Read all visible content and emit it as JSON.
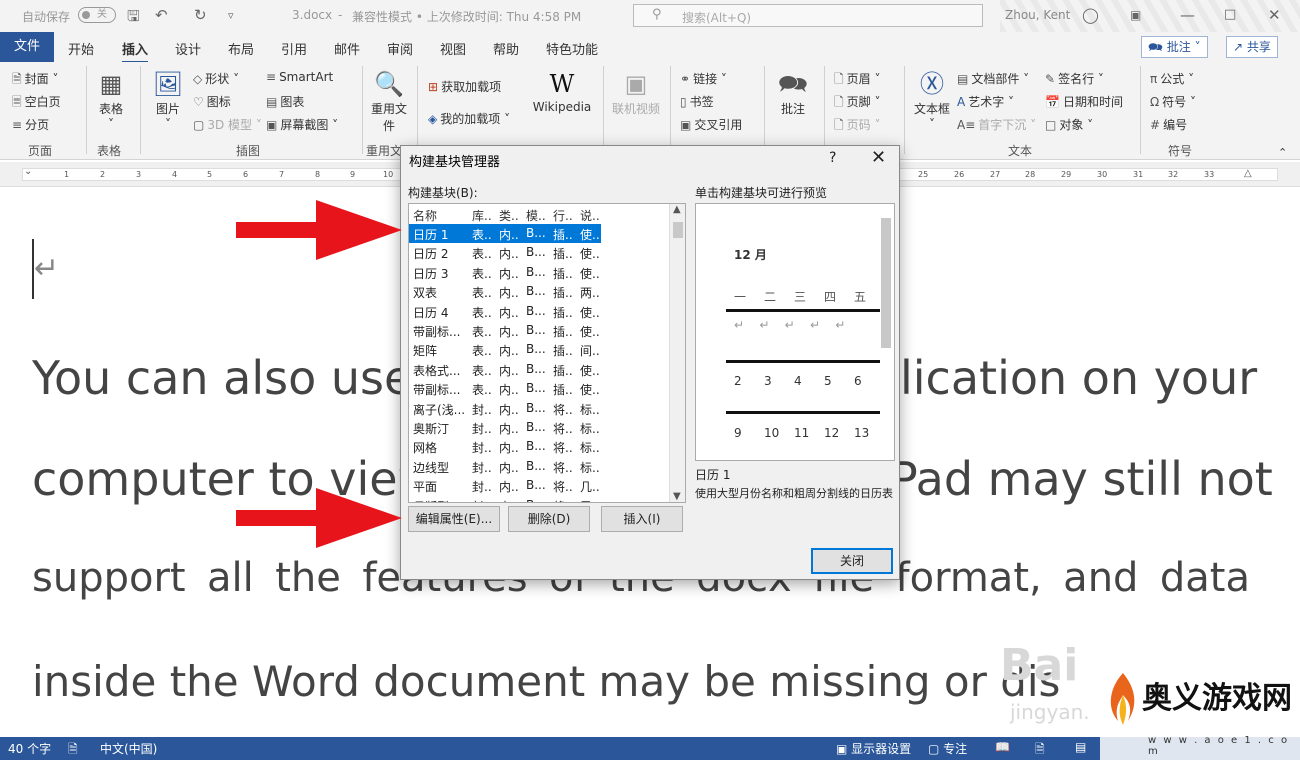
{
  "titlebar": {
    "autosave_label": "自动保存",
    "autosave_state": "关",
    "doc_name": "3.docx",
    "separator": "-",
    "mode": "兼容性模式 • 上次修改时间: Thu 4:58 PM",
    "search_placeholder": "搜索(Alt+Q)",
    "user": "Zhou, Kent"
  },
  "tabs": {
    "file": "文件",
    "items": [
      "开始",
      "插入",
      "设计",
      "布局",
      "引用",
      "邮件",
      "审阅",
      "视图",
      "帮助",
      "特色功能"
    ],
    "active": "插入",
    "comments_button": "批注",
    "share_button": "共享"
  },
  "ribbon": {
    "pages": {
      "cover": "封面",
      "blank": "空白页",
      "break": "分页",
      "group": "页面"
    },
    "tables": {
      "table": "表格",
      "group": "表格"
    },
    "illustrations": {
      "pictures": "图片",
      "shapes": "形状",
      "icons": "图标",
      "models3d": "3D 模型",
      "smartart": "SmartArt",
      "chart": "图表",
      "screenshot": "屏幕截图",
      "group": "插图"
    },
    "reuse": {
      "reuse": "重用文件",
      "group": "重用文"
    },
    "addins": {
      "get": "获取加载项",
      "my": "我的加载项",
      "wikipedia": "Wikipedia"
    },
    "media": {
      "video": "联机视频"
    },
    "links": {
      "link": "链接",
      "bookmark": "书签",
      "crossref": "交叉引用"
    },
    "comments": {
      "comment": "批注"
    },
    "headerfooter": {
      "header": "页眉",
      "footer": "页脚",
      "pagenum": "页码"
    },
    "text": {
      "textbox": "文本框",
      "quickparts": "文档部件",
      "wordart": "艺术字",
      "dropcap": "首字下沉",
      "signature": "签名行",
      "datetime": "日期和时间",
      "object": "对象",
      "group": "文本"
    },
    "symbols": {
      "equation": "公式",
      "symbol": "符号",
      "number": "编号",
      "group": "符号"
    }
  },
  "ruler_ticks": [
    "1",
    "2",
    "3",
    "4",
    "5",
    "6",
    "7",
    "8",
    "9",
    "10",
    "25",
    "26",
    "27",
    "28",
    "29",
    "30",
    "31",
    "32",
    "33"
  ],
  "document": {
    "lines": [
      "You can also use",
      "lication on your",
      "computer to view",
      "Pad may still not",
      "support all the features of the docx file format, and data",
      "inside the Word document may be missing or dis"
    ]
  },
  "dialog": {
    "title": "构建基块管理器",
    "help": "?",
    "list_label": "构建基块(B):",
    "preview_label": "单击构建基块可进行预览",
    "columns": [
      "名称",
      "库..",
      "类..",
      "模..",
      "行..",
      "说.."
    ],
    "rows": [
      [
        "日历 1",
        "表..",
        "内..",
        "B...",
        "插..",
        "使.."
      ],
      [
        "日历 2",
        "表..",
        "内..",
        "B...",
        "插..",
        "使.."
      ],
      [
        "日历 3",
        "表..",
        "内..",
        "B...",
        "插..",
        "使.."
      ],
      [
        "双表",
        "表..",
        "内..",
        "B...",
        "插..",
        "两.."
      ],
      [
        "日历 4",
        "表..",
        "内..",
        "B...",
        "插..",
        "使.."
      ],
      [
        "带副标...",
        "表..",
        "内..",
        "B...",
        "插..",
        "使.."
      ],
      [
        "矩阵",
        "表..",
        "内..",
        "B...",
        "插..",
        "间.."
      ],
      [
        "表格式...",
        "表..",
        "内..",
        "B...",
        "插..",
        "使.."
      ],
      [
        "带副标...",
        "表..",
        "内..",
        "B...",
        "插..",
        "使.."
      ],
      [
        "离子(浅...",
        "封..",
        "内..",
        "B...",
        "将..",
        "标.."
      ],
      [
        "奥斯汀",
        "封..",
        "内..",
        "B...",
        "将..",
        "标.."
      ],
      [
        "网格",
        "封..",
        "内..",
        "B...",
        "将..",
        "标.."
      ],
      [
        "边线型",
        "封..",
        "内..",
        "B...",
        "将..",
        "标.."
      ],
      [
        "平面",
        "封..",
        "内..",
        "B...",
        "将..",
        "几.."
      ],
      [
        "母版型",
        "封..",
        "内..",
        "B...",
        "将..",
        "导.."
      ]
    ],
    "preview": {
      "month": "12 月",
      "weekdays": [
        "一",
        "二",
        "三",
        "四",
        "五"
      ],
      "week2": [
        "2",
        "3",
        "4",
        "5",
        "6"
      ],
      "week3": [
        "9",
        "10",
        "11",
        "12",
        "13"
      ]
    },
    "selected_name": "日历 1",
    "selected_desc": "使用大型月份名称和粗周分割线的日历表",
    "buttons": {
      "edit": "编辑属性(E)...",
      "delete": "删除(D)",
      "insert": "插入(I)",
      "close": "关闭"
    }
  },
  "status": {
    "words": "40 个字",
    "language": "中文(中国)",
    "display": "显示器设置",
    "focus": "专注"
  },
  "watermark": {
    "logo_text": "奥义游戏网",
    "logo_url": "w w w . a o e 1 . c o m"
  },
  "colors": {
    "accent": "#2b579a",
    "selection": "#0078d7",
    "arrow": "#e8141b"
  }
}
